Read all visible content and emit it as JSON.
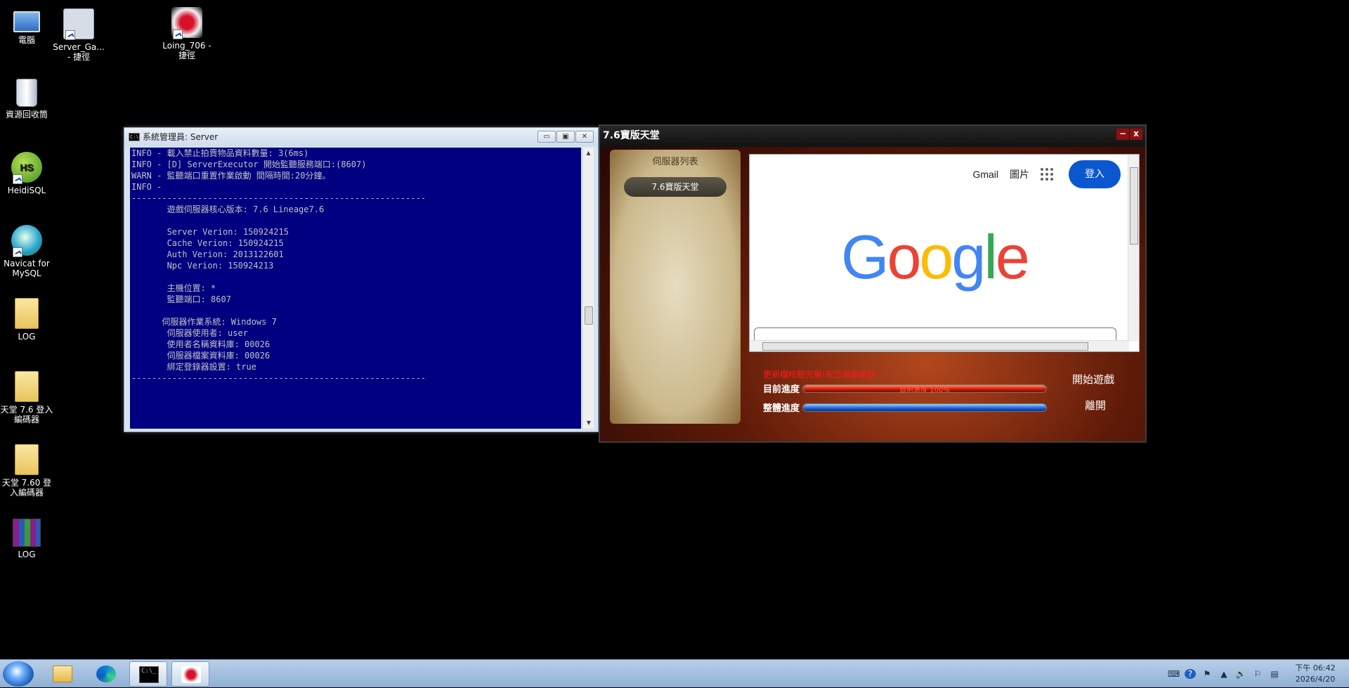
{
  "desktop": {
    "icons": [
      {
        "label": "電腦"
      },
      {
        "label": "Server_Ga...\n- 捷徑"
      },
      {
        "label": "Loing_706 -\n捷徑"
      },
      {
        "label": "資源回收筒"
      },
      {
        "label": "HeidiSQL",
        "badge": "HS"
      },
      {
        "label": "Navicat for\nMySQL"
      },
      {
        "label": "LOG"
      },
      {
        "label": "天堂 7.6 登入\n編碼器"
      },
      {
        "label": "天堂 7.60 登\n入編碼器"
      },
      {
        "label": "LOG"
      }
    ]
  },
  "console": {
    "icon_text": "C:\\",
    "title": "系統管理員: Server",
    "buttons": {
      "minimize": "▭",
      "maximize": "▣",
      "close": "✕"
    },
    "lines": [
      "INFO - 載入禁止拍賣物品資料數量: 3(6ms)",
      "INFO - [D] ServerExecutor 開始監聽服務端口:(8607)",
      "WARN - 監聽端口重置作業啟動 間隔時間:20分鐘。",
      "INFO -",
      "----------------------------------------------------------",
      "       遊戲伺服器核心版本: 7.6 Lineage7.6",
      "",
      "       Server Verion: 150924215",
      "       Cache Verion: 150924215",
      "       Auth Verion: 2013122601",
      "       Npc Verion: 150924213",
      "",
      "       主機位置: *",
      "       監聽端口: 8607",
      "",
      "      伺服器作業系統: Windows 7",
      "       伺服器使用者: user",
      "       使用者名稱資料庫: 00026",
      "       伺服器檔案資料庫: 00026",
      "       綁定登錄器設置: true",
      "----------------------------------------------------------"
    ]
  },
  "launcher": {
    "title": "7.6寶版天堂",
    "controls": {
      "minimize": "−",
      "close": "x"
    },
    "server_list_title": "伺服器列表",
    "servers": [
      "7.6寶版天堂"
    ],
    "browser": {
      "links": [
        "Gmail",
        "圖片"
      ],
      "signin": "登入",
      "logo": [
        "G",
        "o",
        "o",
        "g",
        "l",
        "e"
      ]
    },
    "status_text": "更新檔校驗完畢!祝您遊戲愉快",
    "current_label": "目前進度",
    "current_progress_text": "目前進度 100%",
    "current_progress": 100,
    "total_label": "整體進度",
    "total_progress": 100,
    "start_button": "開始遊戲",
    "exit_button": "離開",
    "colors": {
      "progress_current": "#c81a00",
      "progress_total": "#1a5fd6"
    }
  },
  "taskbar": {
    "items": [
      {
        "name": "start",
        "icon": "windows-orb"
      },
      {
        "name": "explorer",
        "icon": "folder-icon"
      },
      {
        "name": "edge",
        "icon": "edge-icon"
      },
      {
        "name": "cmd",
        "icon": "cmd-icon",
        "text": "C:\\_"
      },
      {
        "name": "lineage",
        "icon": "lineage-icon"
      }
    ],
    "tray_icons": [
      "keyboard-icon",
      "help-icon",
      "flag-icon",
      "arrow-up-icon",
      "volume-icon",
      "action-center-icon",
      "network-icon"
    ],
    "clock_time": "下午 06:42",
    "clock_date": "2026/4/20"
  }
}
